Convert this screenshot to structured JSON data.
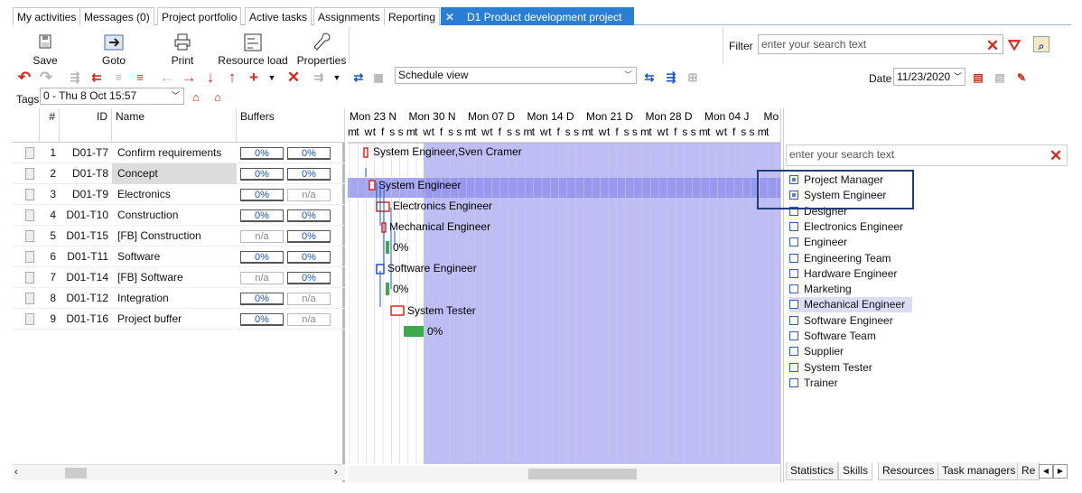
{
  "tabs": [
    "My activities",
    "Messages (0)",
    "Project portfolio",
    "Active tasks",
    "Assignments",
    "Reporting",
    "D1 Product development project"
  ],
  "toolbar": {
    "save": "Save",
    "goto": "Goto",
    "print": "Print",
    "resource_load": "Resource load",
    "properties": "Properties"
  },
  "filter": {
    "label": "Filter",
    "placeholder": "enter your search text"
  },
  "view": {
    "selected": "Schedule view"
  },
  "date": {
    "label": "Date",
    "value": "11/23/2020"
  },
  "tags": {
    "label": "Tags",
    "value": "0 - Thu 8 Oct 15:57"
  },
  "grid": {
    "headers": {
      "num": "#",
      "id": "ID",
      "name": "Name",
      "buffers": "Buffers"
    },
    "rows": [
      {
        "n": "1",
        "id": "D01-T7",
        "name": "Confirm requirements",
        "b1": "0%",
        "b2": "0%"
      },
      {
        "n": "2",
        "id": "D01-T8",
        "name": "Concept",
        "b1": "0%",
        "b2": "0%"
      },
      {
        "n": "3",
        "id": "D01-T9",
        "name": "Electronics",
        "b1": "0%",
        "b2": "n/a"
      },
      {
        "n": "4",
        "id": "D01-T10",
        "name": "Construction",
        "b1": "0%",
        "b2": "0%"
      },
      {
        "n": "5",
        "id": "D01-T15",
        "name": "[FB]  Construction",
        "b1": "n/a",
        "b2": "0%"
      },
      {
        "n": "6",
        "id": "D01-T11",
        "name": "Software",
        "b1": "0%",
        "b2": "0%"
      },
      {
        "n": "7",
        "id": "D01-T14",
        "name": "[FB]  Software",
        "b1": "n/a",
        "b2": "0%"
      },
      {
        "n": "8",
        "id": "D01-T12",
        "name": "Integration",
        "b1": "0%",
        "b2": "n/a"
      },
      {
        "n": "9",
        "id": "D01-T16",
        "name": "Project buffer",
        "b1": "0%",
        "b2": "n/a"
      }
    ]
  },
  "gantt": {
    "weeks": [
      "Mon 23 N",
      "Mon 30 N",
      "Mon 07 D",
      "Mon 14 D",
      "Mon 21 D",
      "Mon 28 D",
      "Mon 04 J",
      "Mo"
    ],
    "days": "mtwtfssmtwtfssmtwtfssmtwtfssmtwtfssmtwtfssmtwtfssmt",
    "labels": [
      "System Engineer,Sven Cramer",
      "System Engineer",
      "Electronics Engineer",
      "Mechanical Engineer",
      "0%",
      "Software Engineer",
      "0%",
      "System Tester",
      "0%"
    ]
  },
  "skills": {
    "placeholder": "enter your search text",
    "items": [
      {
        "label": "Project Manager",
        "checked": true
      },
      {
        "label": "System Engineer",
        "checked": true
      },
      {
        "label": "Designer",
        "checked": false
      },
      {
        "label": "Electronics Engineer",
        "checked": false
      },
      {
        "label": "Engineer",
        "checked": false
      },
      {
        "label": "Engineering Team",
        "checked": false
      },
      {
        "label": "Hardware Engineer",
        "checked": false
      },
      {
        "label": "Marketing",
        "checked": false
      },
      {
        "label": "Mechanical Engineer",
        "checked": false
      },
      {
        "label": "Software Engineer",
        "checked": false
      },
      {
        "label": "Software Team",
        "checked": false
      },
      {
        "label": "Supplier",
        "checked": false
      },
      {
        "label": "System Tester",
        "checked": false
      },
      {
        "label": "Trainer",
        "checked": false
      }
    ]
  },
  "bottom_tabs": [
    "Statistics",
    "Skills",
    "Resources",
    "Task managers",
    "Re"
  ],
  "colors": {
    "accent": "#2a7fd4",
    "gantt_shade": "#a8a8f2",
    "highlight": "#8f8fec",
    "bar_red": "#d8281b",
    "bar_green": "#3daa4f"
  }
}
